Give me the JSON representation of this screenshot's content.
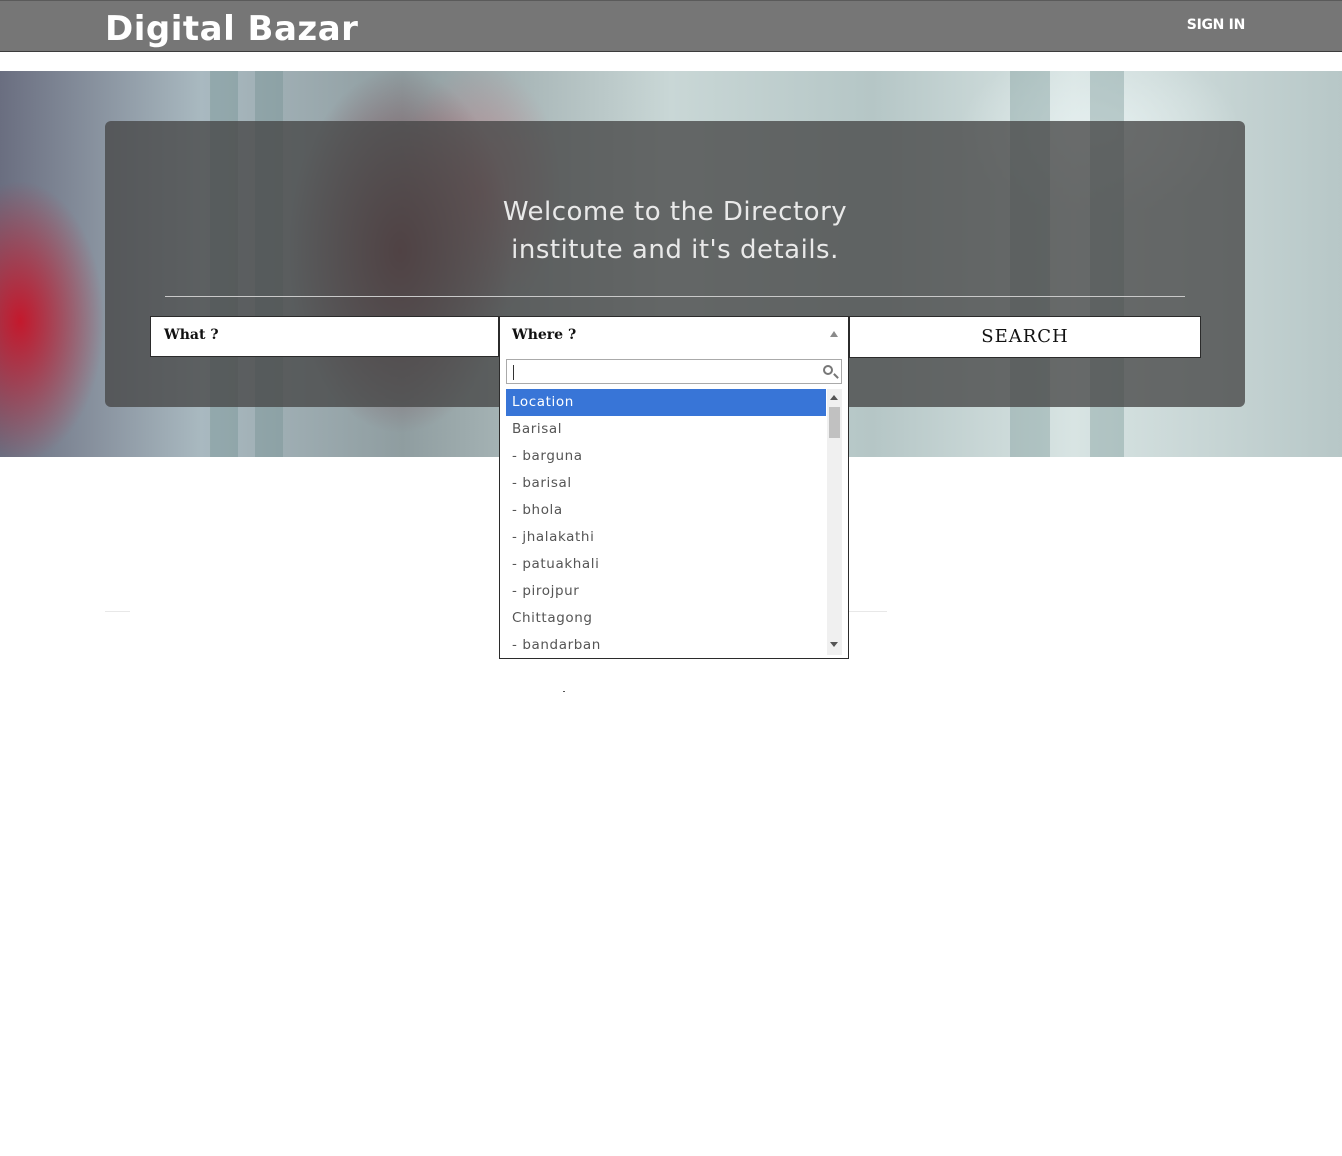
{
  "header": {
    "brand": "Digital Bazar",
    "signin_label": "SIGN IN"
  },
  "hero": {
    "welcome_line1": "Welcome to the Directory",
    "welcome_line2": "institute and it's details."
  },
  "search": {
    "what_placeholder": "What  ?",
    "where_placeholder": "Where ?",
    "button_label": "SEARCH"
  },
  "location_dropdown": {
    "search_value": "",
    "selected": "Location",
    "options": [
      "Location",
      "Barisal",
      "- barguna",
      "- barisal",
      "- bhola",
      "- jhalakathi",
      "- patuakhali",
      "- pirojpur",
      "Chittagong",
      "- bandarban"
    ]
  },
  "colors": {
    "topbar": "#767676",
    "panel": "rgba(70,70,70,0.78)",
    "selected_option": "#3875d7"
  }
}
